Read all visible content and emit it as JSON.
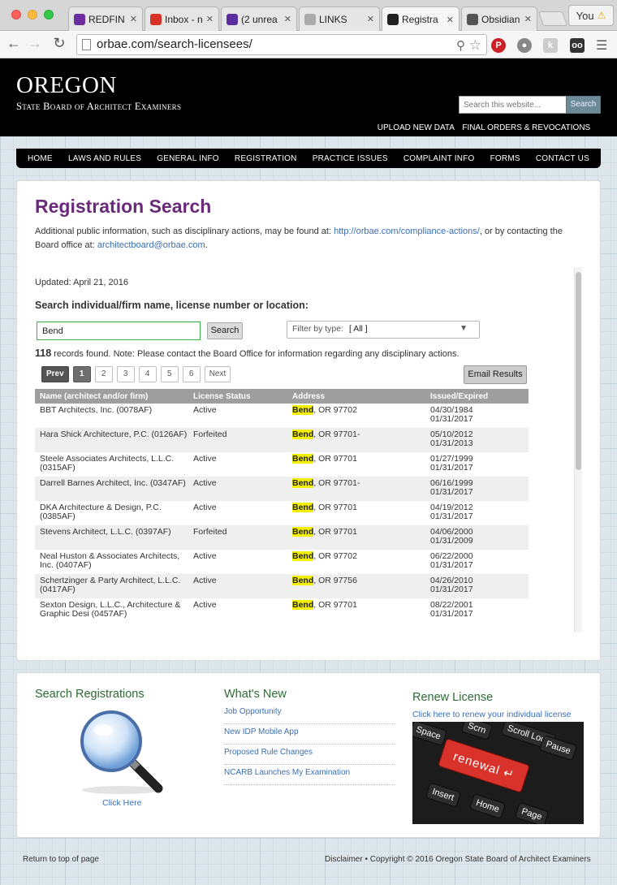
{
  "browser": {
    "tabs": [
      {
        "label": "REDFIN",
        "fav_color": "#6a2ea0"
      },
      {
        "label": "Inbox - n",
        "fav_color": "#d93025"
      },
      {
        "label": "(2 unrea",
        "fav_color": "#5a2ea0"
      },
      {
        "label": "LINKS",
        "fav_color": "#aaaaaa"
      },
      {
        "label": "Registra",
        "fav_color": "#222222"
      },
      {
        "label": "Obsidian",
        "fav_color": "#555555"
      }
    ],
    "active_tab_index": 4,
    "url": "orbae.com/search-licensees/",
    "profile_name": "You"
  },
  "header": {
    "logo_title": "OREGON",
    "logo_subtitle": "State Board of Architect Examiners",
    "search_placeholder": "Search this website...",
    "search_button": "Search",
    "utility_links": [
      "UPLOAD NEW DATA",
      "FINAL ORDERS & REVOCATIONS"
    ]
  },
  "nav": [
    "HOME",
    "LAWS AND RULES",
    "GENERAL INFO",
    "REGISTRATION",
    "PRACTICE ISSUES",
    "COMPLAINT INFO",
    "FORMS",
    "CONTACT US"
  ],
  "main": {
    "title": "Registration Search",
    "intro_prefix": "Additional public information, such as disciplinary actions, may be found at: ",
    "intro_link": "http://orbae.com/compliance-actions/",
    "intro_middle": ", or by contacting the Board office at: ",
    "intro_email": "architectboard@orbae.com",
    "intro_suffix": ".",
    "updated": "Updated: April 21, 2016",
    "search_heading": "Search individual/firm name, license number or location:",
    "query_value": "Bend",
    "search_button": "Search",
    "filter_label": "Filter by type:",
    "filter_value": "[ All ]",
    "records_count": "118",
    "records_text": " records found. Note: Please contact the Board Office for information regarding any disciplinary actions.",
    "pager": {
      "prev": "Prev",
      "pages": [
        "1",
        "2",
        "3",
        "4",
        "5",
        "6"
      ],
      "current": "1",
      "next": "Next"
    },
    "email_button": "Email Results",
    "columns": [
      "Name (architect and/or firm)",
      "License Status",
      "Address",
      "Issued/Expired"
    ],
    "rows": [
      {
        "name": "BBT Architects, Inc. (0078AF)",
        "status": "Active",
        "city": "Bend",
        "rest": ", OR 97702",
        "issued": "04/30/1984",
        "expired": "01/31/2017"
      },
      {
        "name": "Hara Shick Architecture, P.C. (0126AF)",
        "status": "Forfeited",
        "city": "Bend",
        "rest": ", OR 97701-",
        "issued": "05/10/2012",
        "expired": "01/31/2013"
      },
      {
        "name": "Steele Associates Architects, L.L.C. (0315AF)",
        "status": "Active",
        "city": "Bend",
        "rest": ", OR 97701",
        "issued": "01/27/1999",
        "expired": "01/31/2017"
      },
      {
        "name": "Darrell Barnes Architect, Inc. (0347AF)",
        "status": "Active",
        "city": "Bend",
        "rest": ", OR 97701-",
        "issued": "06/16/1999",
        "expired": "01/31/2017"
      },
      {
        "name": "DKA Architecture & Design, P.C. (0385AF)",
        "status": "Active",
        "city": "Bend",
        "rest": ", OR 97701",
        "issued": "04/19/2012",
        "expired": "01/31/2017"
      },
      {
        "name": "Stevens Architect, L.L.C. (0397AF)",
        "status": "Forfeited",
        "city": "Bend",
        "rest": ", OR 97701",
        "issued": "04/06/2000",
        "expired": "01/31/2009"
      },
      {
        "name": "Neal Huston & Associates Architects, Inc. (0407AF)",
        "status": "Active",
        "city": "Bend",
        "rest": ", OR 97702",
        "issued": "06/22/2000",
        "expired": "01/31/2017"
      },
      {
        "name": "Schertzinger & Party Architect, L.L.C. (0417AF)",
        "status": "Active",
        "city": "Bend",
        "rest": ", OR 97756",
        "issued": "04/26/2010",
        "expired": "01/31/2017"
      },
      {
        "name": "Sexton Design, L.L.C., Architecture & Graphic Desi (0457AF)",
        "status": "Active",
        "city": "Bend",
        "rest": ", OR 97701",
        "issued": "08/22/2001",
        "expired": "01/31/2017"
      }
    ]
  },
  "bottom": {
    "search_title": "Search Registrations",
    "search_link": "Click Here",
    "news_title": "What's New",
    "news_items": [
      "Job Opportunity",
      "New IDP Mobile App",
      "Proposed Rule Changes",
      "NCARB Launches My Examination"
    ],
    "renew_title": "Renew License",
    "renew_link": "Click here to renew your individual license",
    "keys": [
      "Space",
      "Scrn",
      "Scroll Lock",
      "Pause",
      "renewal",
      "Insert",
      "Home",
      "Page"
    ]
  },
  "footer": {
    "back_to_top": "Return to top of page",
    "copyright": "Disclaimer • Copyright © 2016 Oregon State Board of Architect Examiners"
  }
}
